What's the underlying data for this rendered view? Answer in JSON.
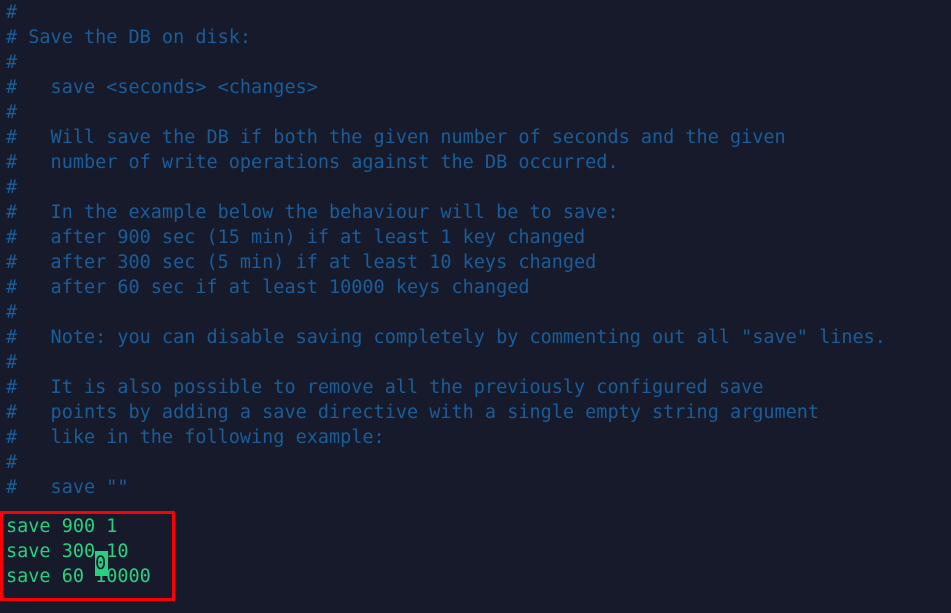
{
  "app": {
    "kind": "terminal-text-editor",
    "file_type": "redis-config"
  },
  "colors": {
    "background": "#161a2b",
    "comment_text": "#1b5d99",
    "directive_text": "#27d17f",
    "annotation_border": "#fb0006",
    "cursor_background": "#27d17f",
    "cursor_glyph": "#161a2b"
  },
  "comment_lines": [
    "#",
    "# Save the DB on disk:",
    "#",
    "#   save <seconds> <changes>",
    "#",
    "#   Will save the DB if both the given number of seconds and the given",
    "#   number of write operations against the DB occurred.",
    "#",
    "#   In the example below the behaviour will be to save:",
    "#   after 900 sec (15 min) if at least 1 key changed",
    "#   after 300 sec (5 min) if at least 10 keys changed",
    "#   after 60 sec if at least 10000 keys changed",
    "#",
    "#   Note: you can disable saving completely by commenting out all \"save\" lines.",
    "#",
    "#   It is also possible to remove all the previously configured save",
    "#   points by adding a save directive with a single empty string argument",
    "#   like in the following example:",
    "#",
    "#   save \"\""
  ],
  "save_block": {
    "lines": [
      "save 900 1",
      "save 300 10",
      "save 60 10000"
    ],
    "highlighted": true
  },
  "cursor": {
    "character": "0",
    "line": "save 300 10",
    "column": 9,
    "row": 22
  }
}
